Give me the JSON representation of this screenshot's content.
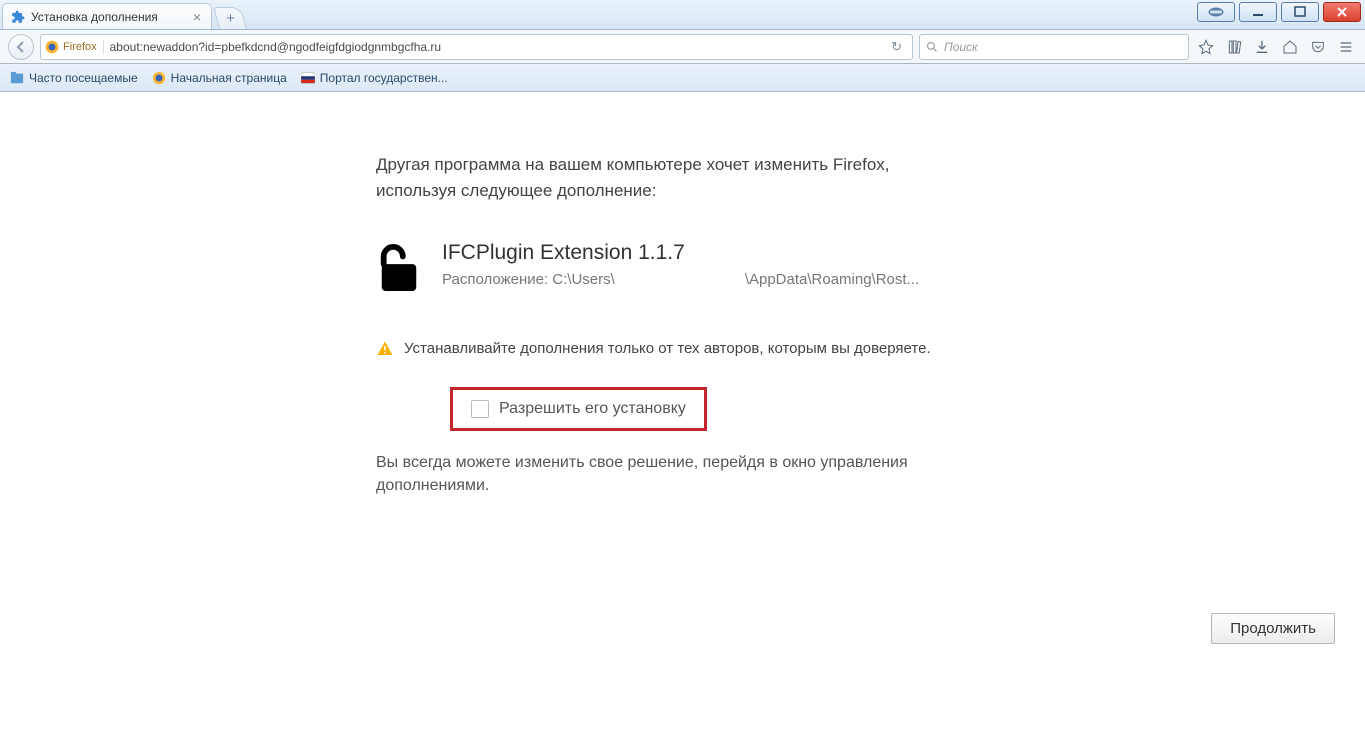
{
  "window": {
    "tab_title": "Установка дополнения"
  },
  "nav": {
    "identity_label": "Firefox",
    "url": "about:newaddon?id=pbefkdcnd@ngodfeigfdgiodgnmbgcfha.ru",
    "search_placeholder": "Поиск"
  },
  "bookmarks": {
    "items": [
      {
        "label": "Часто посещаемые"
      },
      {
        "label": "Начальная страница"
      },
      {
        "label": "Портал государствен..."
      }
    ]
  },
  "page": {
    "lead_line1": "Другая программа на вашем компьютере хочет изменить Firefox,",
    "lead_line2": "используя следующее дополнение:",
    "plugin_name": "IFCPlugin Extension 1.1.7",
    "location_label": "Расположение: ",
    "location_prefix": "C:\\Users\\",
    "location_suffix": "\\AppData\\Roaming\\Rost...",
    "warning_text": "Устанавливайте дополнения только от тех авторов, которым вы доверяете.",
    "allow_label": "Разрешить его установку",
    "note_text": "Вы всегда можете изменить свое решение, перейдя в окно управления дополнениями.",
    "continue_label": "Продолжить"
  }
}
